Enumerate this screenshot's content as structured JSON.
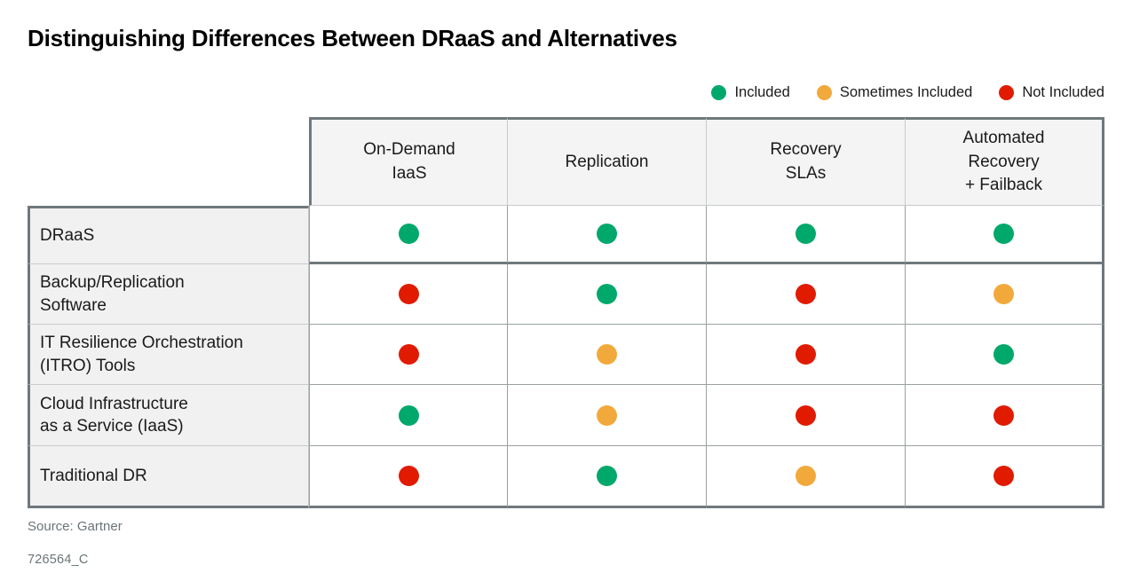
{
  "title": "Distinguishing Differences Between DRaaS and Alternatives",
  "legend": {
    "items": [
      {
        "label": "Included",
        "color": "#00a86b",
        "icon": "green-circle-icon"
      },
      {
        "label": "Sometimes Included",
        "color": "#f2a93b",
        "icon": "orange-circle-icon"
      },
      {
        "label": "Not Included",
        "color": "#e01b00",
        "icon": "red-circle-icon"
      }
    ]
  },
  "colors": {
    "included": "#00a86b",
    "sometimes_included": "#f2a93b",
    "not_included": "#e01b00",
    "border_dark": "#6f787c",
    "border_light": "#9aa0a2",
    "header_fill": "#f4f4f4",
    "rowlabel_fill": "#f1f1f1",
    "text": "#1a1a1a",
    "muted_text": "#6b7478"
  },
  "chart_data": {
    "type": "table",
    "title": "Distinguishing Differences Between DRaaS and Alternatives",
    "columns": [
      "On-Demand\nIaaS",
      "Replication",
      "Recovery\nSLAs",
      "Automated\nRecovery\n+ Failback"
    ],
    "column_lines": [
      [
        "On-Demand",
        "IaaS"
      ],
      [
        "Replication"
      ],
      [
        "Recovery",
        "SLAs"
      ],
      [
        "Automated",
        "Recovery",
        "+ Failback"
      ]
    ],
    "rows": [
      {
        "label": "DRaaS",
        "label_lines": [
          "DRaaS"
        ],
        "values": [
          "Included",
          "Included",
          "Included",
          "Included"
        ]
      },
      {
        "label": "Backup/Replication Software",
        "label_lines": [
          "Backup/Replication",
          "Software"
        ],
        "values": [
          "Not Included",
          "Included",
          "Not Included",
          "Sometimes Included"
        ]
      },
      {
        "label": "IT Resilience Orchestration (ITRO) Tools",
        "label_lines": [
          "IT Resilience Orchestration",
          "(ITRO) Tools"
        ],
        "values": [
          "Not Included",
          "Sometimes Included",
          "Not Included",
          "Included"
        ]
      },
      {
        "label": "Cloud Infrastructure as a Service (IaaS)",
        "label_lines": [
          "Cloud Infrastructure",
          "as a Service (IaaS)"
        ],
        "values": [
          "Included",
          "Sometimes Included",
          "Not Included",
          "Not Included"
        ]
      },
      {
        "label": "Traditional DR",
        "label_lines": [
          "Traditional DR"
        ],
        "values": [
          "Not Included",
          "Included",
          "Sometimes Included",
          "Not Included"
        ]
      }
    ],
    "legend_position": "top-right",
    "grid": true
  },
  "footer": {
    "source": "Source: Gartner",
    "doc_id": "726564_C"
  }
}
